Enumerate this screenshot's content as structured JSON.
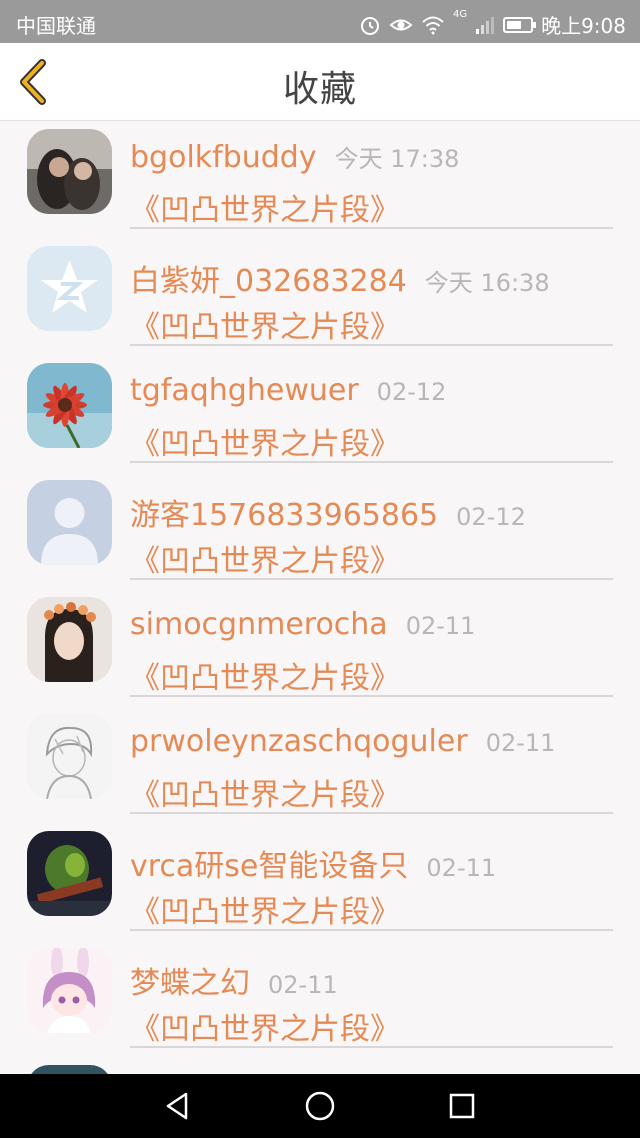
{
  "status_bar": {
    "carrier": "中国联通",
    "network": "4G",
    "time": "晚上9:08",
    "icons": [
      "alarm-icon",
      "eye-icon",
      "wifi-icon",
      "signal-icon",
      "battery-icon"
    ]
  },
  "header": {
    "title": "收藏",
    "back_icon": "chevron-left-icon"
  },
  "favorites": [
    {
      "username": "bgolkfbuddy",
      "time": "今天 17:38",
      "book": "《凹凸世界之片段》",
      "avatar": "photo-couple"
    },
    {
      "username": "白紫妍_032683284",
      "time": "今天 16:38",
      "book": "《凹凸世界之片段》",
      "avatar": "qq-star-default"
    },
    {
      "username": "tgfaqhghewuer",
      "time": "02-12",
      "book": "《凹凸世界之片段》",
      "avatar": "red-flower"
    },
    {
      "username": "游客1576833965865",
      "time": "02-12",
      "book": "《凹凸世界之片段》",
      "avatar": "default-person"
    },
    {
      "username": "simocgnmerocha",
      "time": "02-11",
      "book": "《凹凸世界之片段》",
      "avatar": "girl-flower-crown"
    },
    {
      "username": "prwoleynzaschqoguler",
      "time": "02-11",
      "book": "《凹凸世界之片段》",
      "avatar": "sketch-boy"
    },
    {
      "username": "vrca研se智能设备只",
      "time": "02-11",
      "book": "《凹凸世界之片段》",
      "avatar": "green-warrior"
    },
    {
      "username": "梦蝶之幻",
      "time": "02-11",
      "book": "《凹凸世界之片段》",
      "avatar": "anime-bunny-girl"
    }
  ],
  "nav_bar": {
    "icons": [
      "back-triangle-icon",
      "home-circle-icon",
      "recents-square-icon"
    ]
  },
  "colors": {
    "accent": "#e58a55",
    "time_gray": "#b8b6b6",
    "status_bar": "#9a9a9a",
    "back_icon": "#f0b020"
  }
}
